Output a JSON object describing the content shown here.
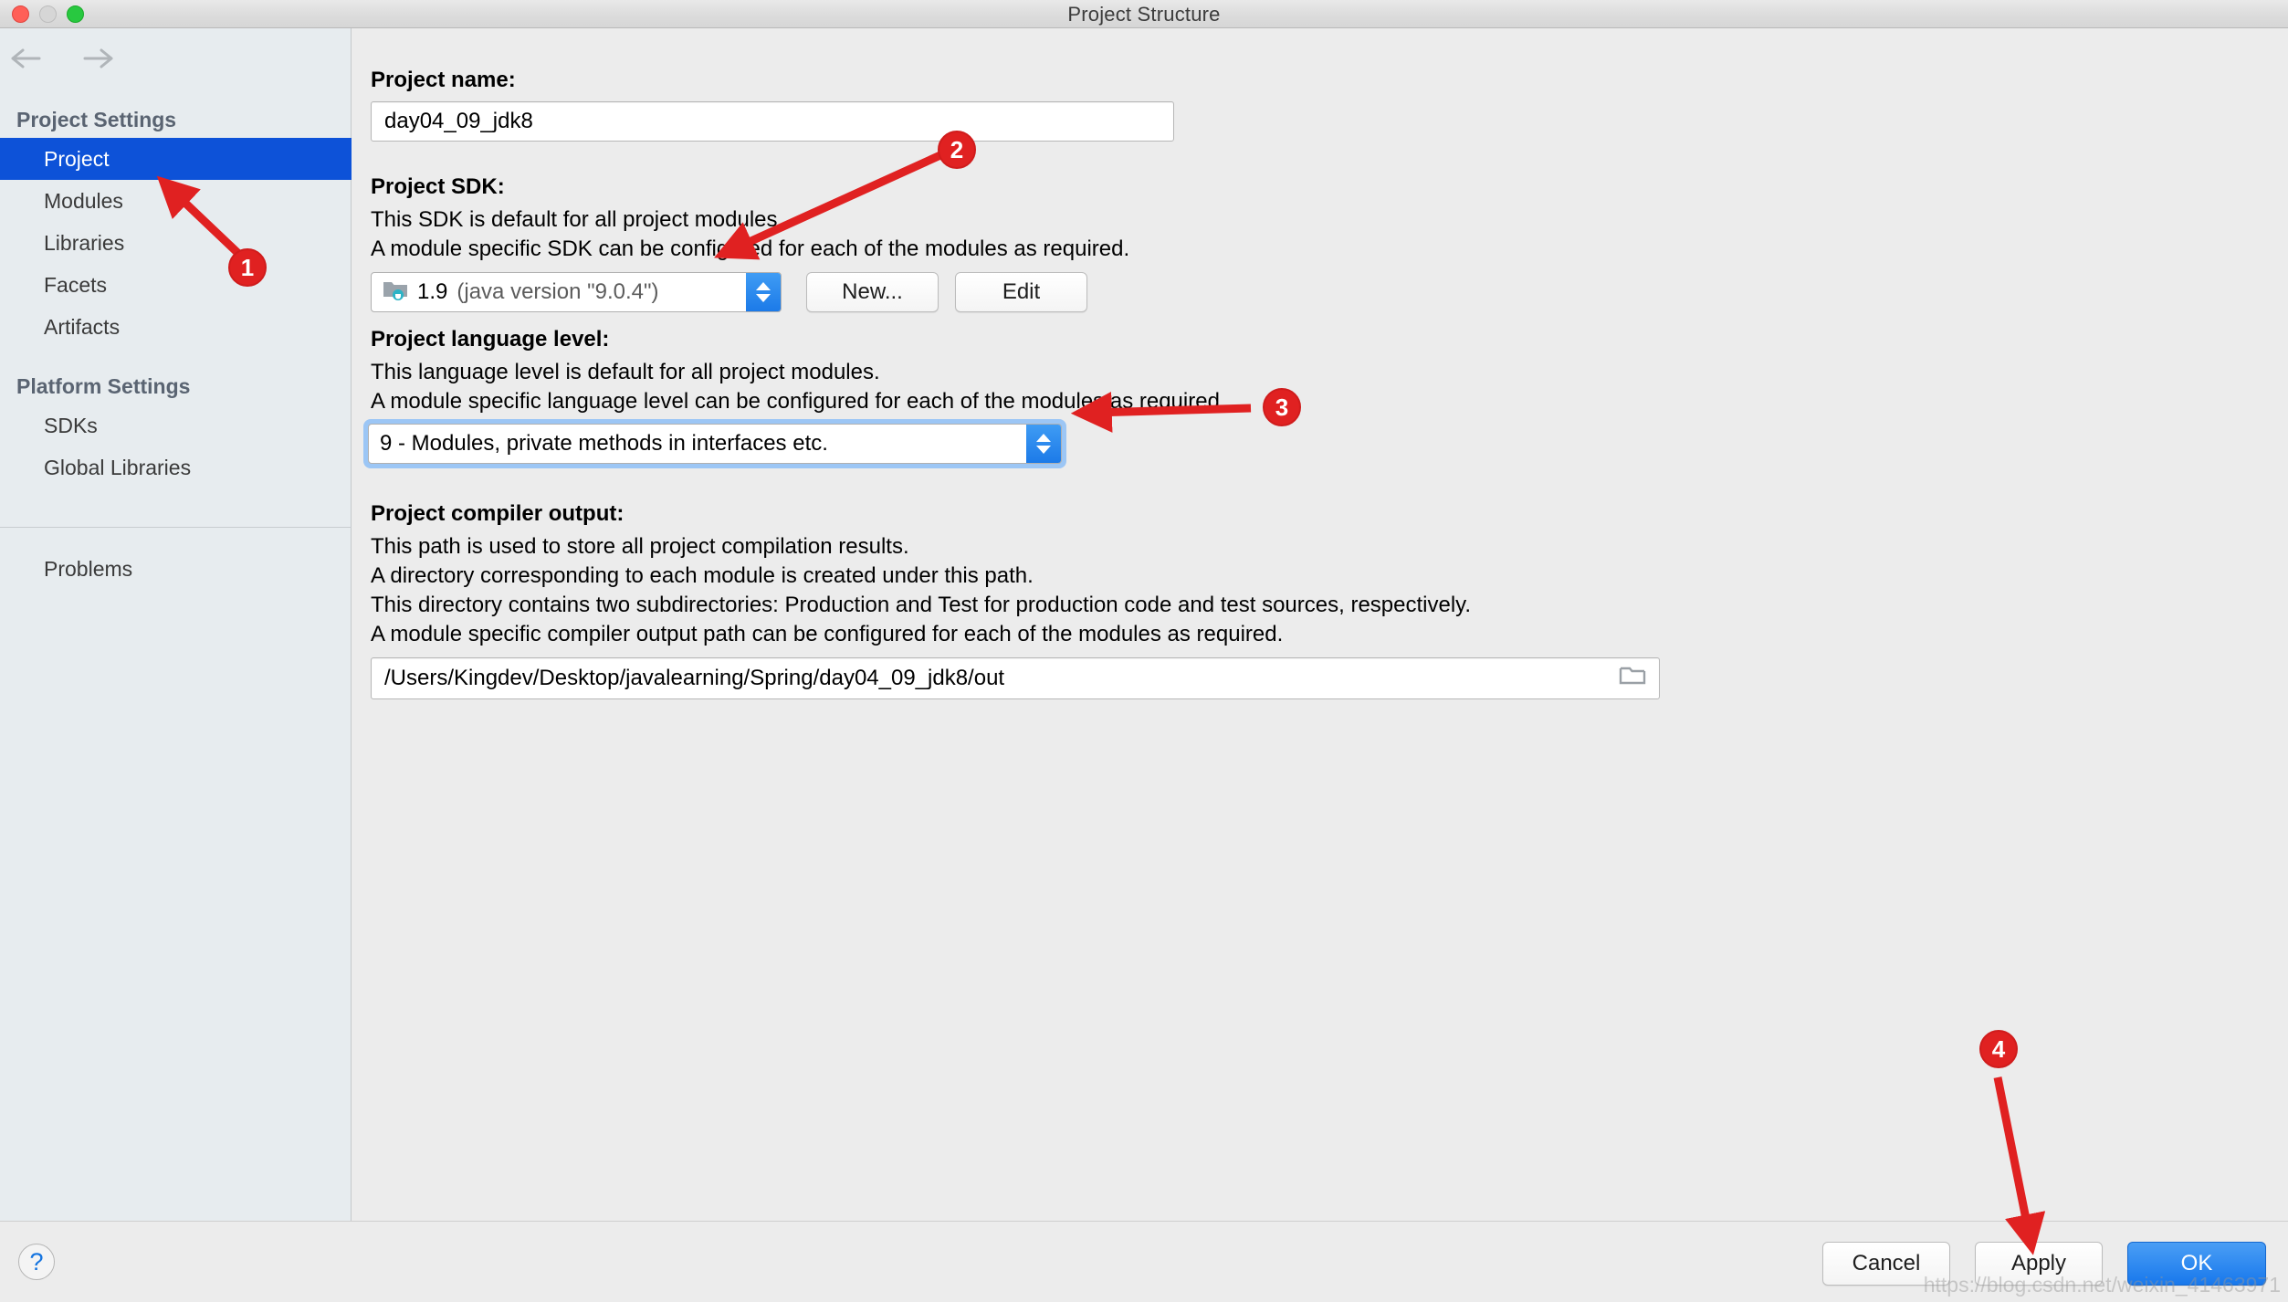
{
  "window": {
    "title": "Project Structure",
    "traffic_lights": [
      "close",
      "minimize",
      "zoom"
    ]
  },
  "nav": {
    "back_icon": "arrow-left-icon",
    "forward_icon": "arrow-right-icon"
  },
  "sidebar": {
    "project_settings": {
      "heading": "Project Settings",
      "items": [
        {
          "label": "Project",
          "selected": true
        },
        {
          "label": "Modules",
          "selected": false
        },
        {
          "label": "Libraries",
          "selected": false
        },
        {
          "label": "Facets",
          "selected": false
        },
        {
          "label": "Artifacts",
          "selected": false
        }
      ]
    },
    "platform_settings": {
      "heading": "Platform Settings",
      "items": [
        {
          "label": "SDKs",
          "selected": false
        },
        {
          "label": "Global Libraries",
          "selected": false
        }
      ]
    },
    "problems": {
      "label": "Problems"
    }
  },
  "main": {
    "project_name": {
      "label": "Project name:",
      "value": "day04_09_jdk8"
    },
    "project_sdk": {
      "label": "Project SDK:",
      "description": [
        "This SDK is default for all project modules",
        "A module specific SDK can be configured for each of the modules as required."
      ],
      "selected_version": "1.9",
      "selected_detail": "(java version \"9.0.4\")",
      "sdk_icon": "java-sdk-folder-icon",
      "new_button": "New...",
      "edit_button": "Edit"
    },
    "language_level": {
      "label": "Project language level:",
      "description": [
        "This language level is default for all project modules.",
        "A module specific language level can be configured for each of the modules as required."
      ],
      "selected": "9 - Modules, private methods in interfaces etc.",
      "focused": true
    },
    "compiler_output": {
      "label": "Project compiler output:",
      "description": [
        "This path is used to store all project compilation results.",
        "A directory corresponding to each module is created under this path.",
        "This directory contains two subdirectories: Production and Test for production code and test sources, respectively.",
        "A module specific compiler output path can be configured for each of the modules as required."
      ],
      "path": "/Users/Kingdev/Desktop/javalearning/Spring/day04_09_jdk8/out",
      "browse_icon": "folder-browse-icon"
    }
  },
  "footer": {
    "help_icon": "question-mark-icon",
    "cancel_button": "Cancel",
    "apply_button": "Apply",
    "ok_button": "OK",
    "watermark": "https://blog.csdn.net/weixin_41463971"
  },
  "annotations": {
    "color": "#e02121",
    "markers": [
      {
        "number": "1",
        "target": "sidebar-item-project"
      },
      {
        "number": "2",
        "target": "project-sdk-combo"
      },
      {
        "number": "3",
        "target": "language-level-combo"
      },
      {
        "number": "4",
        "target": "apply-button"
      }
    ]
  }
}
